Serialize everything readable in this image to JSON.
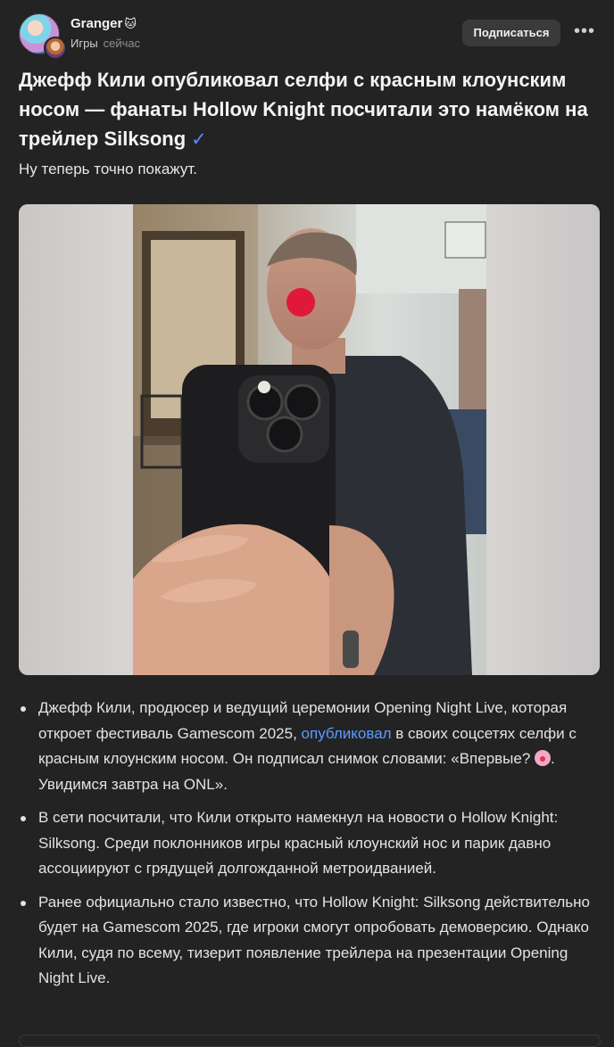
{
  "post": {
    "author": "Granger",
    "author_emoji": "🐱",
    "category": "Игры",
    "time": "сейчас",
    "subscribe_label": "Подписаться",
    "more_label": "•••",
    "title": "Джефф Кили опубликовал селфи с красным клоунским носом — фанаты Hollow Knight посчитали это намёком на трейлер Silksong",
    "verified_icon": "✓",
    "subtitle": "Ну теперь точно покажут."
  },
  "bullets": [
    {
      "p1": "Джефф Кили, продюсер и ведущий церемонии Opening Night Live, которая откроет фестиваль Gamescom 2025, ",
      "link": "опубликовал",
      "p2": " в своих соцсетях селфи с красным клоунским носом. Он подписал снимок словами: «Впервые? ",
      "p3": ". Увидимся завтра на ONL»."
    },
    {
      "text": "В сети посчитали, что Кили открыто намекнул на новости о Hollow Knight: Silksong. Среди поклонников игры красный клоунский нос и парик давно ассоциируют с грядущей долгожданной метроидванией."
    },
    {
      "text": "Ранее официально стало известно, что Hollow Knight: Silksong действительно будет на Gamescom 2025, где игроки смогут опробовать демоверсию. Однако Кили, судя по всему, тизерит появление трейлера на презентации Opening Night Live."
    }
  ],
  "colors": {
    "background": "#232323",
    "link": "#5b9bff",
    "verified": "#5a8cff",
    "button": "#3a3a3a"
  },
  "icons": [
    "avatar",
    "cat-emoji-icon",
    "verified-check-icon",
    "more-dots-icon",
    "clown-face-emoji-icon"
  ]
}
